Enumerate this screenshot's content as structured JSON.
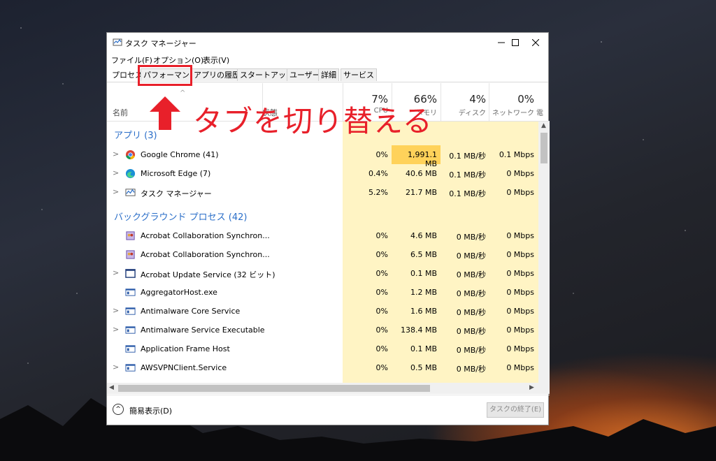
{
  "window": {
    "title": "タスク マネージャー"
  },
  "menu": [
    {
      "label": "ファイル(F)"
    },
    {
      "label": "オプション(O)"
    },
    {
      "label": "表示(V)"
    }
  ],
  "tabs": [
    {
      "label": "プロセス",
      "selected": false
    },
    {
      "label": "パフォーマンス",
      "selected": true
    },
    {
      "label": "アプリの履歴",
      "selected": false
    },
    {
      "label": "スタートアップ",
      "selected": false
    },
    {
      "label": "ユーザー",
      "selected": false
    },
    {
      "label": "詳細",
      "selected": false
    },
    {
      "label": "サービス",
      "selected": false
    }
  ],
  "columns": {
    "name": "名前",
    "status": "状態",
    "cpu": {
      "pct": "7%",
      "label": "CPU"
    },
    "memory": {
      "pct": "66%",
      "label": "メモリ"
    },
    "disk": {
      "pct": "4%",
      "label": "ディスク"
    },
    "network": {
      "pct": "0%",
      "label": "ネットワーク"
    },
    "power": {
      "label": "電"
    }
  },
  "groups": {
    "apps": "アプリ (3)",
    "background": "バックグラウンド プロセス (42)"
  },
  "app_rows": [
    {
      "name": "Google Chrome (41)",
      "cpu": "0%",
      "mem": "1,991.1 MB",
      "disk": "0.1 MB/秒",
      "net": "0.1 Mbps",
      "icon": "chrome-icon"
    },
    {
      "name": "Microsoft Edge (7)",
      "cpu": "0.4%",
      "mem": "40.6 MB",
      "disk": "0.1 MB/秒",
      "net": "0 Mbps",
      "icon": "edge-icon"
    },
    {
      "name": "タスク マネージャー",
      "cpu": "5.2%",
      "mem": "21.7 MB",
      "disk": "0.1 MB/秒",
      "net": "0 Mbps",
      "icon": "task-manager-icon"
    }
  ],
  "bg_rows": [
    {
      "name": "Acrobat Collaboration Synchron...",
      "cpu": "0%",
      "mem": "4.6 MB",
      "disk": "0 MB/秒",
      "net": "0 Mbps",
      "icon": "acrobat-collab-icon",
      "expandable": false
    },
    {
      "name": "Acrobat Collaboration Synchron...",
      "cpu": "0%",
      "mem": "6.5 MB",
      "disk": "0 MB/秒",
      "net": "0 Mbps",
      "icon": "acrobat-collab-icon",
      "expandable": false
    },
    {
      "name": "Acrobat Update Service (32 ビット)",
      "cpu": "0%",
      "mem": "0.1 MB",
      "disk": "0 MB/秒",
      "net": "0 Mbps",
      "icon": "service-icon",
      "expandable": true
    },
    {
      "name": "AggregatorHost.exe",
      "cpu": "0%",
      "mem": "1.2 MB",
      "disk": "0 MB/秒",
      "net": "0 Mbps",
      "icon": "app-window-icon",
      "expandable": false
    },
    {
      "name": "Antimalware Core Service",
      "cpu": "0%",
      "mem": "1.6 MB",
      "disk": "0 MB/秒",
      "net": "0 Mbps",
      "icon": "app-window-icon",
      "expandable": true
    },
    {
      "name": "Antimalware Service Executable",
      "cpu": "0%",
      "mem": "138.4 MB",
      "disk": "0 MB/秒",
      "net": "0 Mbps",
      "icon": "app-window-icon",
      "expandable": true
    },
    {
      "name": "Application Frame Host",
      "cpu": "0%",
      "mem": "0.1 MB",
      "disk": "0 MB/秒",
      "net": "0 Mbps",
      "icon": "app-window-icon",
      "expandable": false
    },
    {
      "name": "AWSVPNClient.Service",
      "cpu": "0%",
      "mem": "0.5 MB",
      "disk": "0 MB/秒",
      "net": "0 Mbps",
      "icon": "app-window-icon",
      "expandable": true
    }
  ],
  "footer": {
    "simple_view": "簡易表示(D)",
    "end_task": "タスクの終了(E)"
  },
  "annotation": {
    "text": "タブを切り替える"
  },
  "colors": {
    "accent": "#2a6ec8",
    "annotation": "#e8202a",
    "heat_light": "#fff4c4",
    "heat_strong": "#ffd25a"
  }
}
